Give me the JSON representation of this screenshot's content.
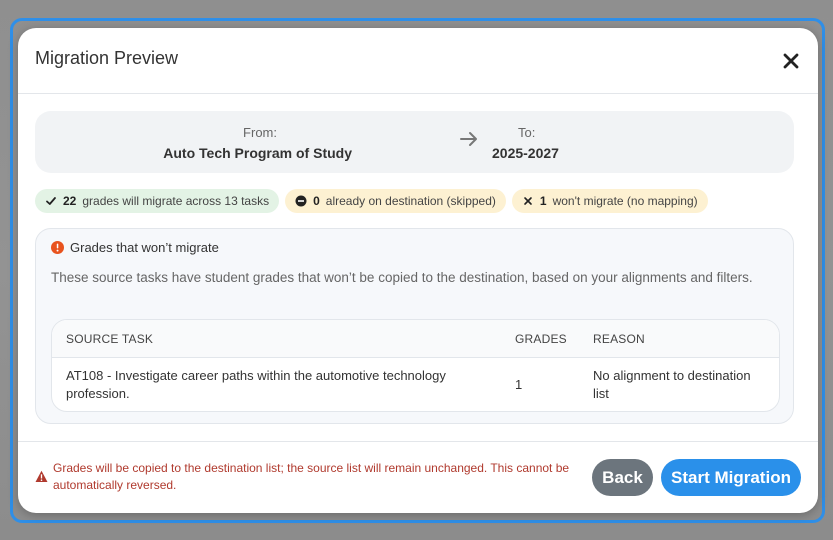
{
  "modal": {
    "title": "Migration Preview",
    "close_icon": "close-icon"
  },
  "route": {
    "from_label": "From:",
    "from_value": "Auto Tech Program of Study",
    "to_label": "To:",
    "to_value": "2025-2027",
    "arrow_icon": "arrow-right-icon"
  },
  "badges": [
    {
      "icon": "check-icon",
      "count": "22",
      "text": "grades will migrate across 13 tasks",
      "color": "#e3f3e5"
    },
    {
      "icon": "minus-circle-icon",
      "count": "0",
      "text": "already on destination (skipped)",
      "color": "#fdf1d2"
    },
    {
      "icon": "x-icon",
      "count": "1",
      "text": "won't migrate (no mapping)",
      "color": "#fdf1d2"
    }
  ],
  "warning_panel": {
    "icon": "info-icon",
    "title": "Grades that won’t migrate",
    "description": "These source tasks have student grades that won’t be copied to the destination, based on your alignments and filters.",
    "columns": [
      "SOURCE TASK",
      "GRADES",
      "REASON"
    ],
    "rows": [
      {
        "task": "AT108 - Investigate career paths within the automotive technology profession.",
        "grades": "1",
        "reason": "No alignment to destination list"
      }
    ]
  },
  "footer": {
    "warning_icon": "warning-triangle-icon",
    "warning_text": "Grades will be copied to the destination list; the source list will remain unchanged. This cannot be automatically reversed.",
    "back_label": "Back",
    "start_label": "Start Migration"
  },
  "colors": {
    "accent": "#2a90ea",
    "back_button": "#6c757d",
    "warning_text": "#b03a2e",
    "info_icon": "#e8531e"
  }
}
